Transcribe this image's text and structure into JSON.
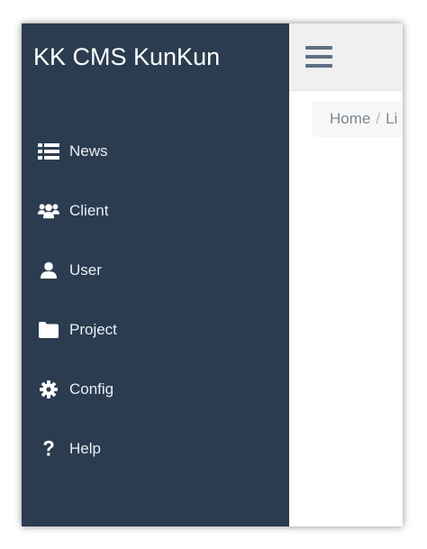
{
  "brand": {
    "title": "KK CMS KunKun"
  },
  "sidebar": {
    "items": [
      {
        "label": "News",
        "icon": "list-icon"
      },
      {
        "label": "Client",
        "icon": "users-icon"
      },
      {
        "label": "User",
        "icon": "user-icon"
      },
      {
        "label": "Project",
        "icon": "folder-icon"
      },
      {
        "label": "Config",
        "icon": "gear-icon"
      },
      {
        "label": "Help",
        "icon": "question-icon"
      }
    ]
  },
  "breadcrumb": {
    "items": [
      "Home",
      "Li"
    ],
    "separator": "/"
  },
  "colors": {
    "sidebar_bg": "#2b3c50",
    "topbar_bg": "#f0f0f0",
    "hamburger": "#5d6f84",
    "menu_text": "#e9eef3",
    "breadcrumb_text": "#7c8791"
  }
}
